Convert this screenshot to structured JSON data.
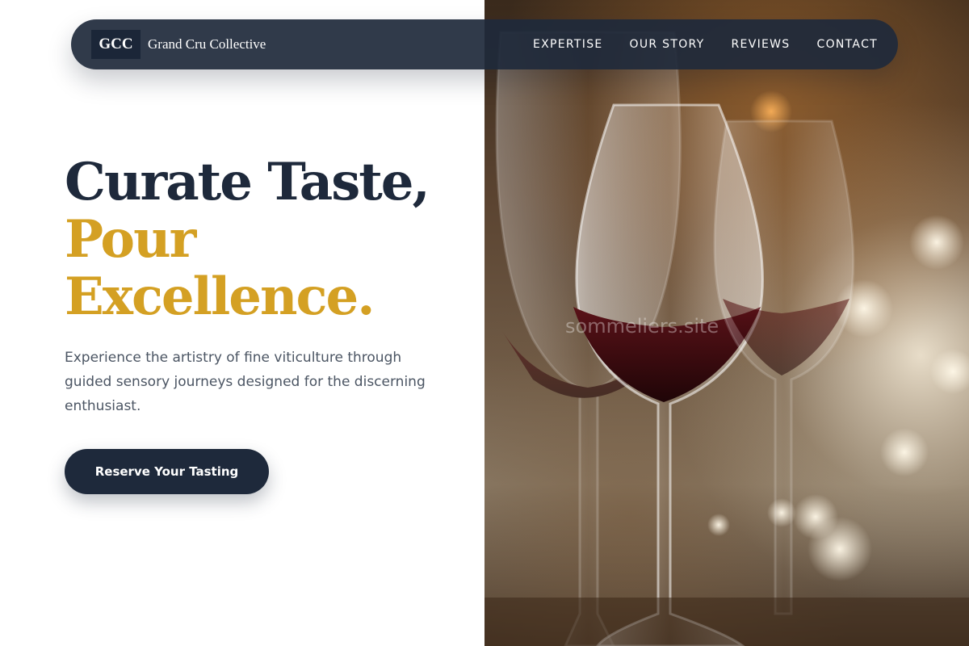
{
  "brand": {
    "mark": "GCC",
    "name": "Grand Cru Collective"
  },
  "nav": {
    "items": [
      {
        "label": "EXPERTISE"
      },
      {
        "label": "OUR STORY"
      },
      {
        "label": "REVIEWS"
      },
      {
        "label": "CONTACT"
      }
    ]
  },
  "hero": {
    "title_line1": "Curate Taste,",
    "title_line2": "Pour",
    "title_line3": "Excellence.",
    "subtitle": "Experience the artistry of fine viticulture through guided sensory journeys designed for the discerning enthusiast.",
    "cta_label": "Reserve Your Tasting",
    "image_watermark": "sommeliers.site"
  },
  "colors": {
    "navy": "#1e293b",
    "gold": "#d4a023",
    "text_muted": "#4b5563"
  },
  "icons": {
    "hero_image": "wine-glasses-photo"
  }
}
